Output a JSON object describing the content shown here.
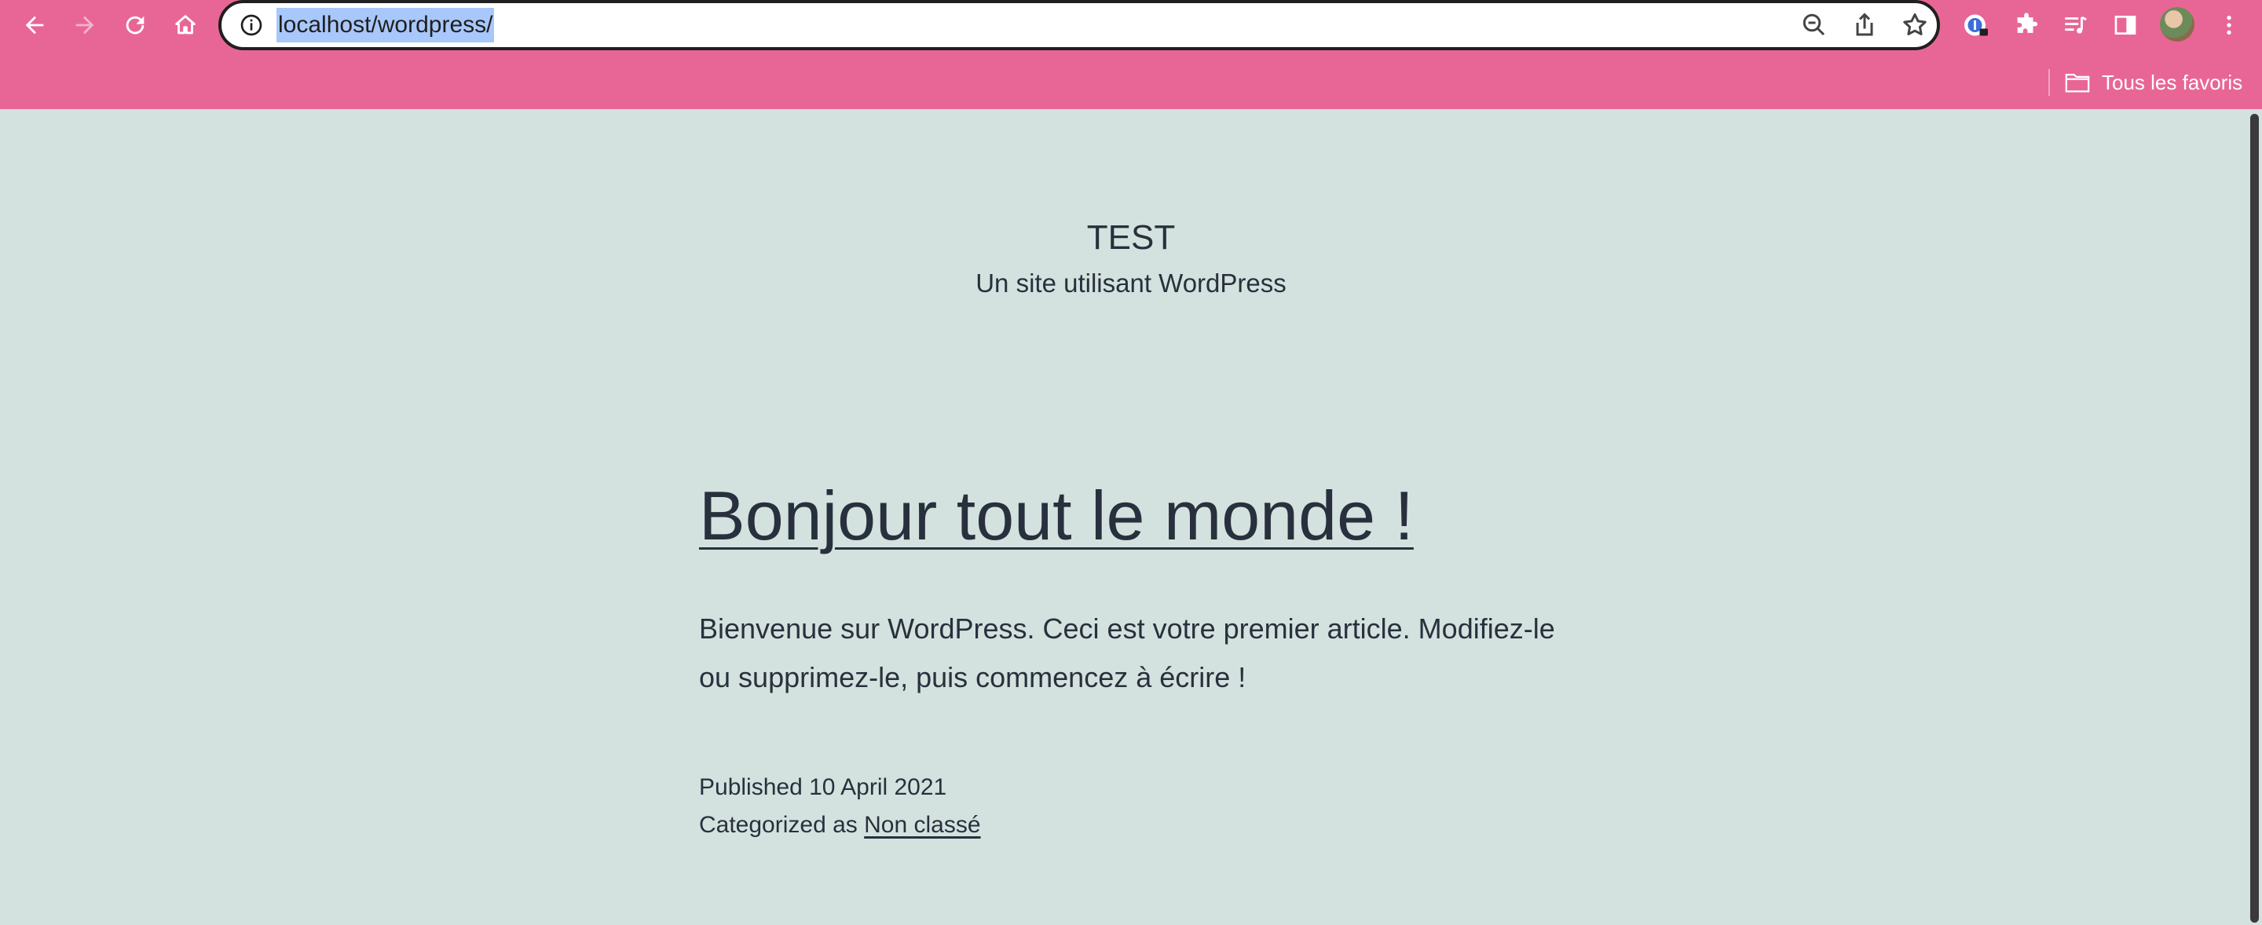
{
  "browser": {
    "url": "localhost/wordpress/",
    "bookmarks_label": "Tous les favoris",
    "icons": [
      "back-arrow-icon",
      "forward-arrow-icon",
      "reload-icon",
      "home-icon",
      "site-info-icon",
      "zoom-out-icon",
      "share-icon",
      "star-icon",
      "password-manager-icon",
      "extensions-icon",
      "media-queue-icon",
      "side-panel-icon",
      "more-menu-icon",
      "folder-icon"
    ],
    "colors": {
      "toolbar": "#e86695",
      "page_background": "#d3e2de",
      "text": "#28303d",
      "url_highlight": "#a8c7fa"
    }
  },
  "site": {
    "title": "TEST",
    "description": "Un site utilisant WordPress"
  },
  "post": {
    "title": "Bonjour tout le monde !",
    "body": "Bienvenue sur WordPress. Ceci est votre premier article. Modifiez-le ou supprimez-le, puis commencez à écrire !",
    "published": "Published 10 April 2021",
    "categorized_prefix": "Categorized as",
    "category": "Non classé"
  }
}
